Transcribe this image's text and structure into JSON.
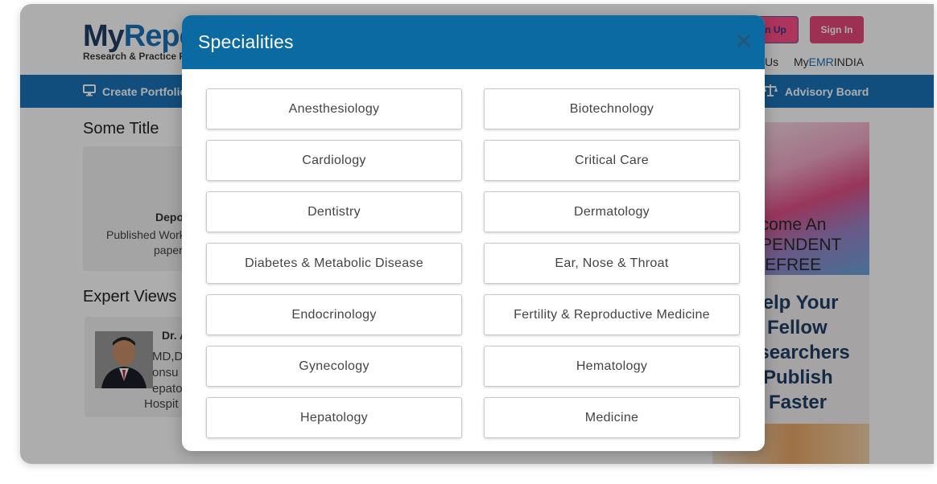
{
  "header": {
    "logo": {
      "text_dark": "My",
      "text_accent": "Repo",
      "tagline": "Research & Practice F"
    },
    "sign_up_label": "n Up",
    "sign_in_label": "Sign In",
    "links": [
      {
        "label": "Us"
      },
      {
        "label_pre": "My",
        "label_emr": "EMR",
        "label_post": "INDIA"
      }
    ]
  },
  "nav": {
    "create_portfolio": "Create Portfolio",
    "advisory_board": "Advisory Board"
  },
  "main": {
    "section1_title": "Some Title",
    "card1": {
      "line1": "Depo",
      "line2": "Published Work",
      "line3": "paper"
    },
    "section2_title": "Expert Views",
    "expert": {
      "name": "Dr. A",
      "line1": "MD,DM",
      "line2": "onsu",
      "line3": "epato",
      "line4": "Hospit"
    }
  },
  "ad": {
    "lines1": [
      "ecome An",
      "EPENDENT",
      "REFREE"
    ],
    "lines2": [
      "lelp Your",
      "Fellow",
      "esearchers",
      "Publish",
      "Faster"
    ]
  },
  "modal": {
    "title": "Specialities",
    "close_symbol": "✕",
    "items": [
      "Anesthesiology",
      "Biotechnology",
      "Cardiology",
      "Critical Care",
      "Dentistry",
      "Dermatology",
      "Diabetes & Metabolic Disease",
      "Ear, Nose & Throat",
      "Endocrinology",
      "Fertility & Reproductive Medicine",
      "Gynecology",
      "Hematology",
      "Hepatology",
      "Medicine"
    ]
  },
  "colors": {
    "modal_header": "#0a6aa1",
    "nav_bar": "#1b74b8",
    "sign_in": "#e8497b"
  }
}
